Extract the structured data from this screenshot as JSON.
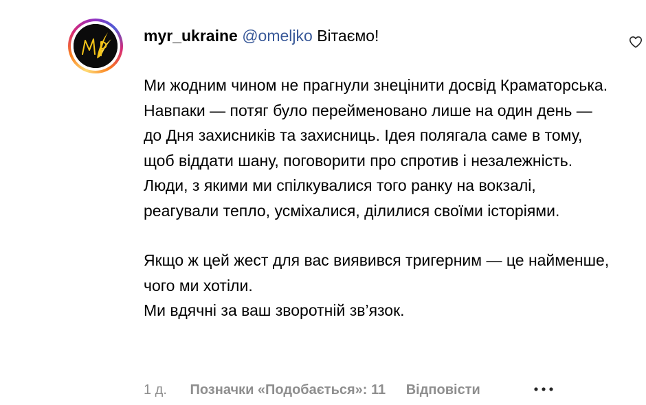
{
  "comment": {
    "username": "myr_ukraine",
    "mention": "@omeljko",
    "greeting": "Вітаємо!",
    "paragraph1": "Ми жодним чином не прагнули знецінити досвід Краматорська. Навпаки — потяг було перейменовано лише на один день — до Дня захисників та захисниць. Ідея полягала саме в тому, щоб віддати шану, поговорити про спротив і незалежність. Люди, з якими ми спілкувалися того ранку на вокзалі, реагували тепло, усміхалися, ділилися своїми історіями.",
    "paragraph2_line1": "Якщо ж цей жест для вас виявився тригерним — це найменше, чого ми хотіли.",
    "paragraph2_line2": "Ми вдячні за ваш зворотній зв’язок.",
    "timestamp": "1 д.",
    "likes_label": "Позначки «Подобається»: 11",
    "reply_label": "Відповісти"
  },
  "icons": {
    "like": "heart-outline-icon",
    "more": "more-horizontal-icon"
  },
  "colors": {
    "mention": "#385898",
    "secondary_text": "#8e8e8e",
    "avatar_background": "#0b0b0b",
    "avatar_accent": "#f5c518"
  }
}
